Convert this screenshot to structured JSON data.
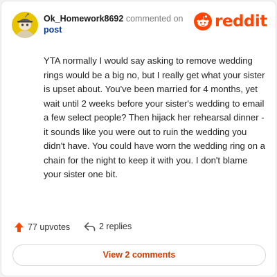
{
  "comment": {
    "username": "Ok_Homework8692",
    "action": "commented on",
    "target": "post",
    "body": "YTA normally I would say asking to remove wedding rings would be a big no, but I really get what your sister is upset about. You've been married for 4 months, yet wait until 2 weeks before your sister's wedding to email a few select people? Then hijack her rehearsal dinner - it sounds like you were out to ruin the wedding you didn't have. You could have worn the wedding ring on a chain for the night to keep it with you. I don't blame your sister one bit."
  },
  "brand": {
    "wordmark": "reddit",
    "color": "#ff4500"
  },
  "footer": {
    "upvotes": "77 upvotes",
    "replies": "2 replies",
    "view_comments": "View 2 comments"
  },
  "icons": {
    "avatar": "snoo-avatar-icon",
    "logo": "reddit-snoo-icon",
    "upvote": "upvote-arrow-icon",
    "reply": "reply-arrow-icon"
  },
  "colors": {
    "upvote": "#ff4500",
    "link": "#0a3a9a",
    "button_text": "#d93900",
    "avatar_bg": "#e7c300"
  }
}
